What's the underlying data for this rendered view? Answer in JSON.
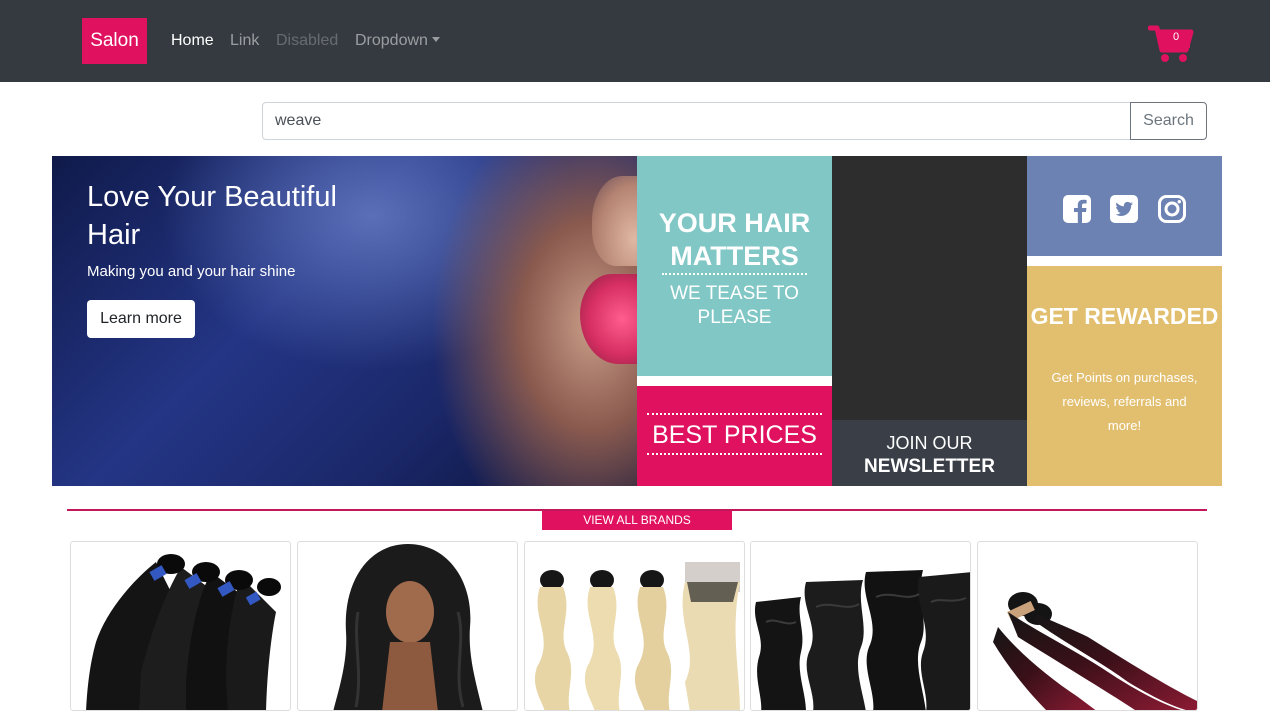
{
  "navbar": {
    "brand": "Salon",
    "links": [
      {
        "label": "Home",
        "state": "active"
      },
      {
        "label": "Link",
        "state": "normal"
      },
      {
        "label": "Disabled",
        "state": "disabled"
      },
      {
        "label": "Dropdown",
        "state": "dropdown"
      }
    ],
    "cart": {
      "icon": "shopping-cart-icon",
      "count": "0",
      "color": "#e0115f"
    }
  },
  "search": {
    "value": "weave",
    "button_label": "Search"
  },
  "hero": {
    "title": "Love Your Beautiful Hair",
    "subtitle": "Making you and your hair shine",
    "button_label": "Learn more"
  },
  "tiles": {
    "hair_matters": {
      "title": "YOUR HAIR MATTERS",
      "subtitle": "WE TEASE TO PLEASE",
      "color": "#80c7c5"
    },
    "best_prices": {
      "label": "BEST PRICES",
      "color": "#e0115f"
    },
    "newsletter": {
      "line1": "JOIN OUR",
      "line2": "NEWSLETTER"
    },
    "social": {
      "icons": [
        "facebook-icon",
        "twitter-icon",
        "instagram-icon"
      ],
      "color": "#6c82b3"
    },
    "rewards": {
      "title": "GET REWARDED",
      "text": "Get Points on purchases, reviews, referrals and more!",
      "color": "#e2bf6f"
    }
  },
  "brands": {
    "button_label": "VIEW ALL BRANDS"
  },
  "products": [
    {
      "image": "straight-black-bundles"
    },
    {
      "image": "body-wave-wig-model"
    },
    {
      "image": "blonde-body-wave-bundles"
    },
    {
      "image": "deep-wave-black-bundles"
    },
    {
      "image": "ombre-burgundy-straight-bundles"
    }
  ]
}
